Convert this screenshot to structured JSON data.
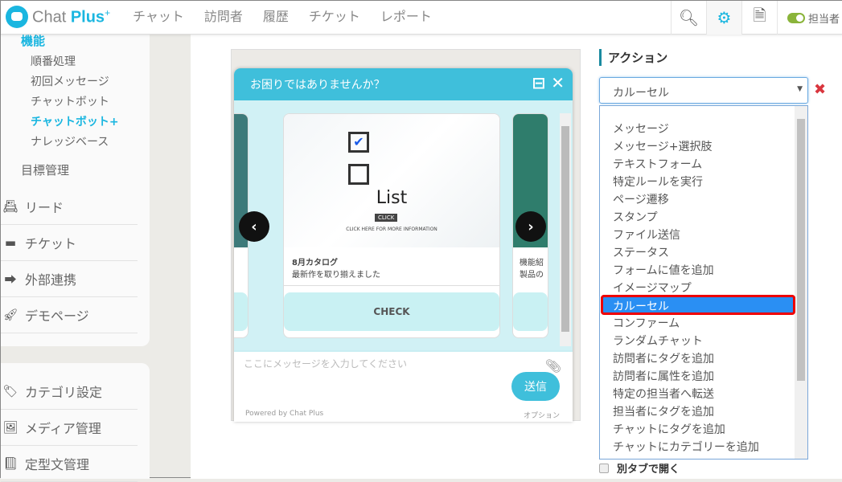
{
  "header": {
    "brand_a": "Chat",
    "brand_b": "Plus",
    "brand_sup": "+",
    "nav": [
      "チャット",
      "訪問者",
      "履歴",
      "チケット",
      "レポート"
    ],
    "icons": [
      "search-icon",
      "gear-icon",
      "document-icon"
    ],
    "toggle_label": "担当者",
    "accent": "#1ab6e0"
  },
  "sidebar": {
    "section": "機能",
    "subitems": [
      "順番処理",
      "初回メッセージ",
      "チャットボット",
      "チャットボット+",
      "ナレッジベース"
    ],
    "active_sub": "チャットボット+",
    "goal": "目標管理",
    "items": [
      {
        "icon": "lead-card-icon",
        "label": "リード"
      },
      {
        "icon": "ticket-icon",
        "label": "チケット"
      },
      {
        "icon": "share-icon",
        "label": "外部連携"
      },
      {
        "icon": "rocket-icon",
        "label": "デモページ"
      }
    ],
    "items2": [
      {
        "icon": "tag-icon",
        "label": "カテゴリ設定"
      },
      {
        "icon": "media-icon",
        "label": "メディア管理"
      },
      {
        "icon": "book-icon",
        "label": "定型文管理"
      }
    ]
  },
  "chat": {
    "title": "お困りではありませんか？",
    "card": {
      "image_text": "List",
      "image_click": "CLICK",
      "image_more": "CLICK HERE FOR MORE INFORMATION",
      "title": "8月カタログ",
      "desc": "最新作を取り揃えました",
      "button": "CHECK"
    },
    "right_card": {
      "title": "機能紹",
      "desc": "製品の"
    },
    "placeholder": "ここにメッセージを入力してください",
    "send": "送信",
    "powered": "Powered by Chat Plus",
    "option": "オプション",
    "header_color": "#3fbfdb"
  },
  "action": {
    "heading": "アクション",
    "selected": "カルーセル",
    "options": [
      "メッセージ",
      "メッセージ+選択肢",
      "テキストフォーム",
      "特定ルールを実行",
      "ページ遷移",
      "スタンプ",
      "ファイル送信",
      "ステータス",
      "フォームに値を追加",
      "イメージマップ",
      "カルーセル",
      "コンファーム",
      "ランダムチャット",
      "訪問者にタグを追加",
      "訪問者に属性を追加",
      "特定の担当者へ転送",
      "担当者にタグを追加",
      "チャットにタグを追加",
      "チャットにカテゴリーを追加"
    ],
    "new_tab": "別タブで開く",
    "highlight_color": "#e00000"
  }
}
